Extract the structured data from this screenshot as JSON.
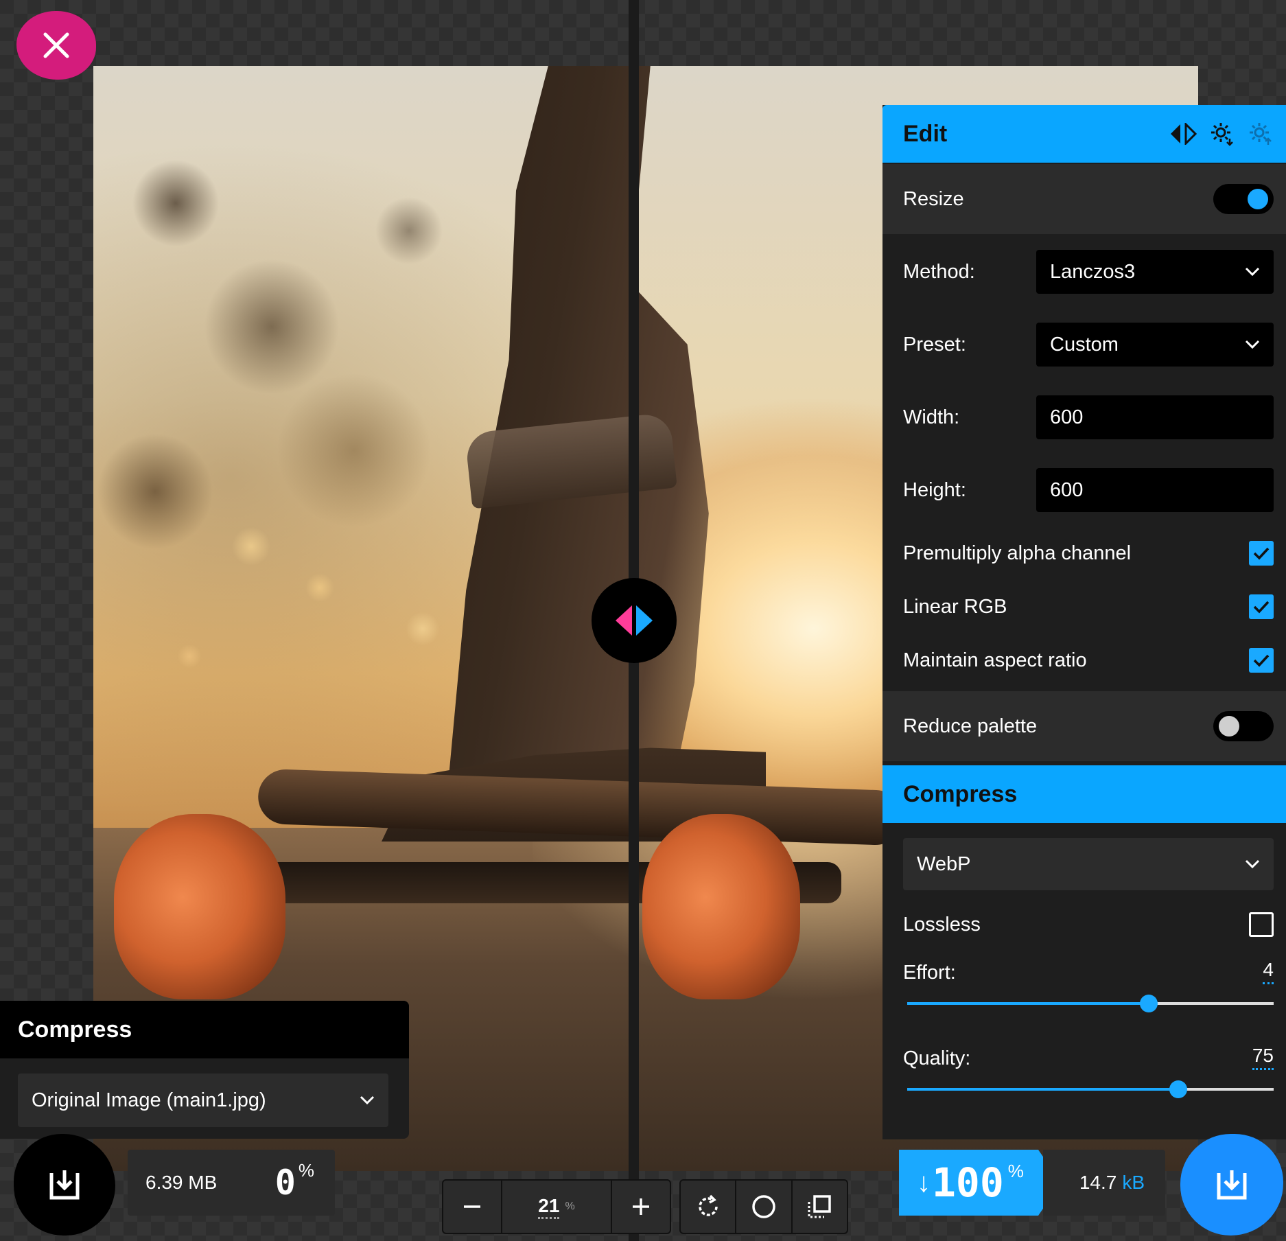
{
  "editor": {
    "panel_title": "Edit",
    "resize_label": "Resize",
    "resize_on": true,
    "method_label": "Method:",
    "method_value": "Lanczos3",
    "preset_label": "Preset:",
    "preset_value": "Custom",
    "width_label": "Width:",
    "width_value": "600",
    "height_label": "Height:",
    "height_value": "600",
    "premultiply_label": "Premultiply alpha channel",
    "premultiply_checked": true,
    "linear_rgb_label": "Linear RGB",
    "linear_rgb_checked": true,
    "aspect_label": "Maintain aspect ratio",
    "aspect_checked": true,
    "reduce_palette_label": "Reduce palette",
    "reduce_palette_on": false
  },
  "compress_right": {
    "title": "Compress",
    "format": "WebP",
    "lossless_label": "Lossless",
    "lossless_checked": false,
    "effort_label": "Effort:",
    "effort_value": "4",
    "effort_fraction": 0.66,
    "quality_label": "Quality:",
    "quality_value": "75",
    "quality_fraction": 0.74
  },
  "compress_left": {
    "title": "Compress",
    "source": "Original Image (main1.jpg)"
  },
  "stats_left": {
    "size": "6.39 MB",
    "percent": "0",
    "percent_symbol": "%"
  },
  "stats_right": {
    "arrow": "↓",
    "percent": "100",
    "percent_symbol": "%",
    "size": "14.7",
    "unit": "kB"
  },
  "zoom": {
    "value": "21",
    "symbol": "%"
  },
  "colors": {
    "accent_blue": "#1aa9ff",
    "close_pink": "#d41c7c",
    "handle_pink": "#ff3d9a"
  },
  "icons": {
    "close": "close-icon",
    "compare": "compare-arrows-icon",
    "settings_import": "settings-import-icon",
    "settings_export": "settings-export-icon",
    "download": "download-icon",
    "zoom_out": "minus-icon",
    "zoom_in": "plus-icon",
    "rotate": "rotate-icon",
    "background": "circle-background-icon",
    "fit": "fit-screen-icon"
  }
}
